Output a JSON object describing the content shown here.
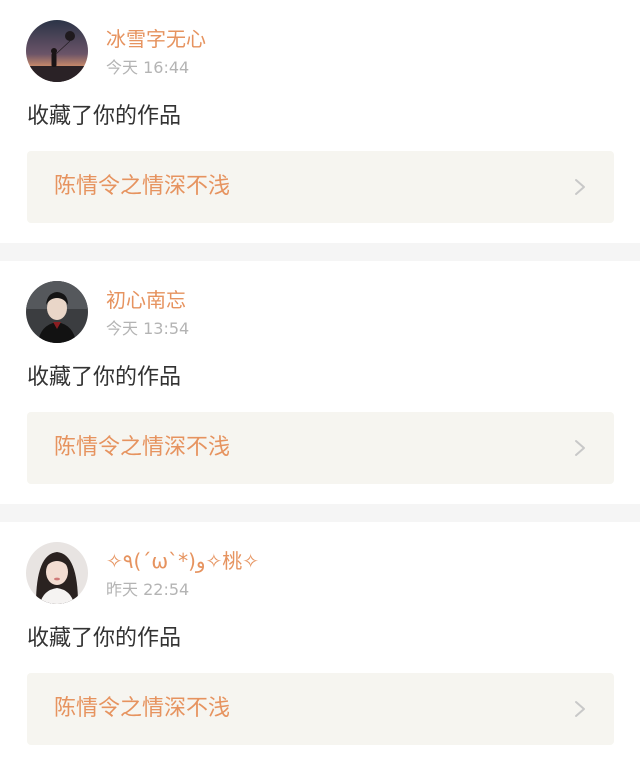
{
  "notifications": [
    {
      "username": "冰雪字无心",
      "time": "今天 16:44",
      "action": "收藏了你的作品",
      "work_title": "陈情令之情深不浅",
      "avatar_icon": "avatar-silhouette-sunset"
    },
    {
      "username": "初心南忘",
      "time": "今天 13:54",
      "action": "收藏了你的作品",
      "work_title": "陈情令之情深不浅",
      "avatar_icon": "avatar-man-dark"
    },
    {
      "username": "✧٩(ˊωˋ*)و✧桃✧",
      "time": "昨天 22:54",
      "action": "收藏了你的作品",
      "work_title": "陈情令之情深不浅",
      "avatar_icon": "avatar-girl-portrait"
    }
  ],
  "colors": {
    "accent": "#e6935f",
    "time_text": "#b4b4b4",
    "body_text": "#333333",
    "work_box_bg": "#f6f5f0",
    "separator": "#f5f5f5",
    "chevron": "#c8c8c8"
  }
}
